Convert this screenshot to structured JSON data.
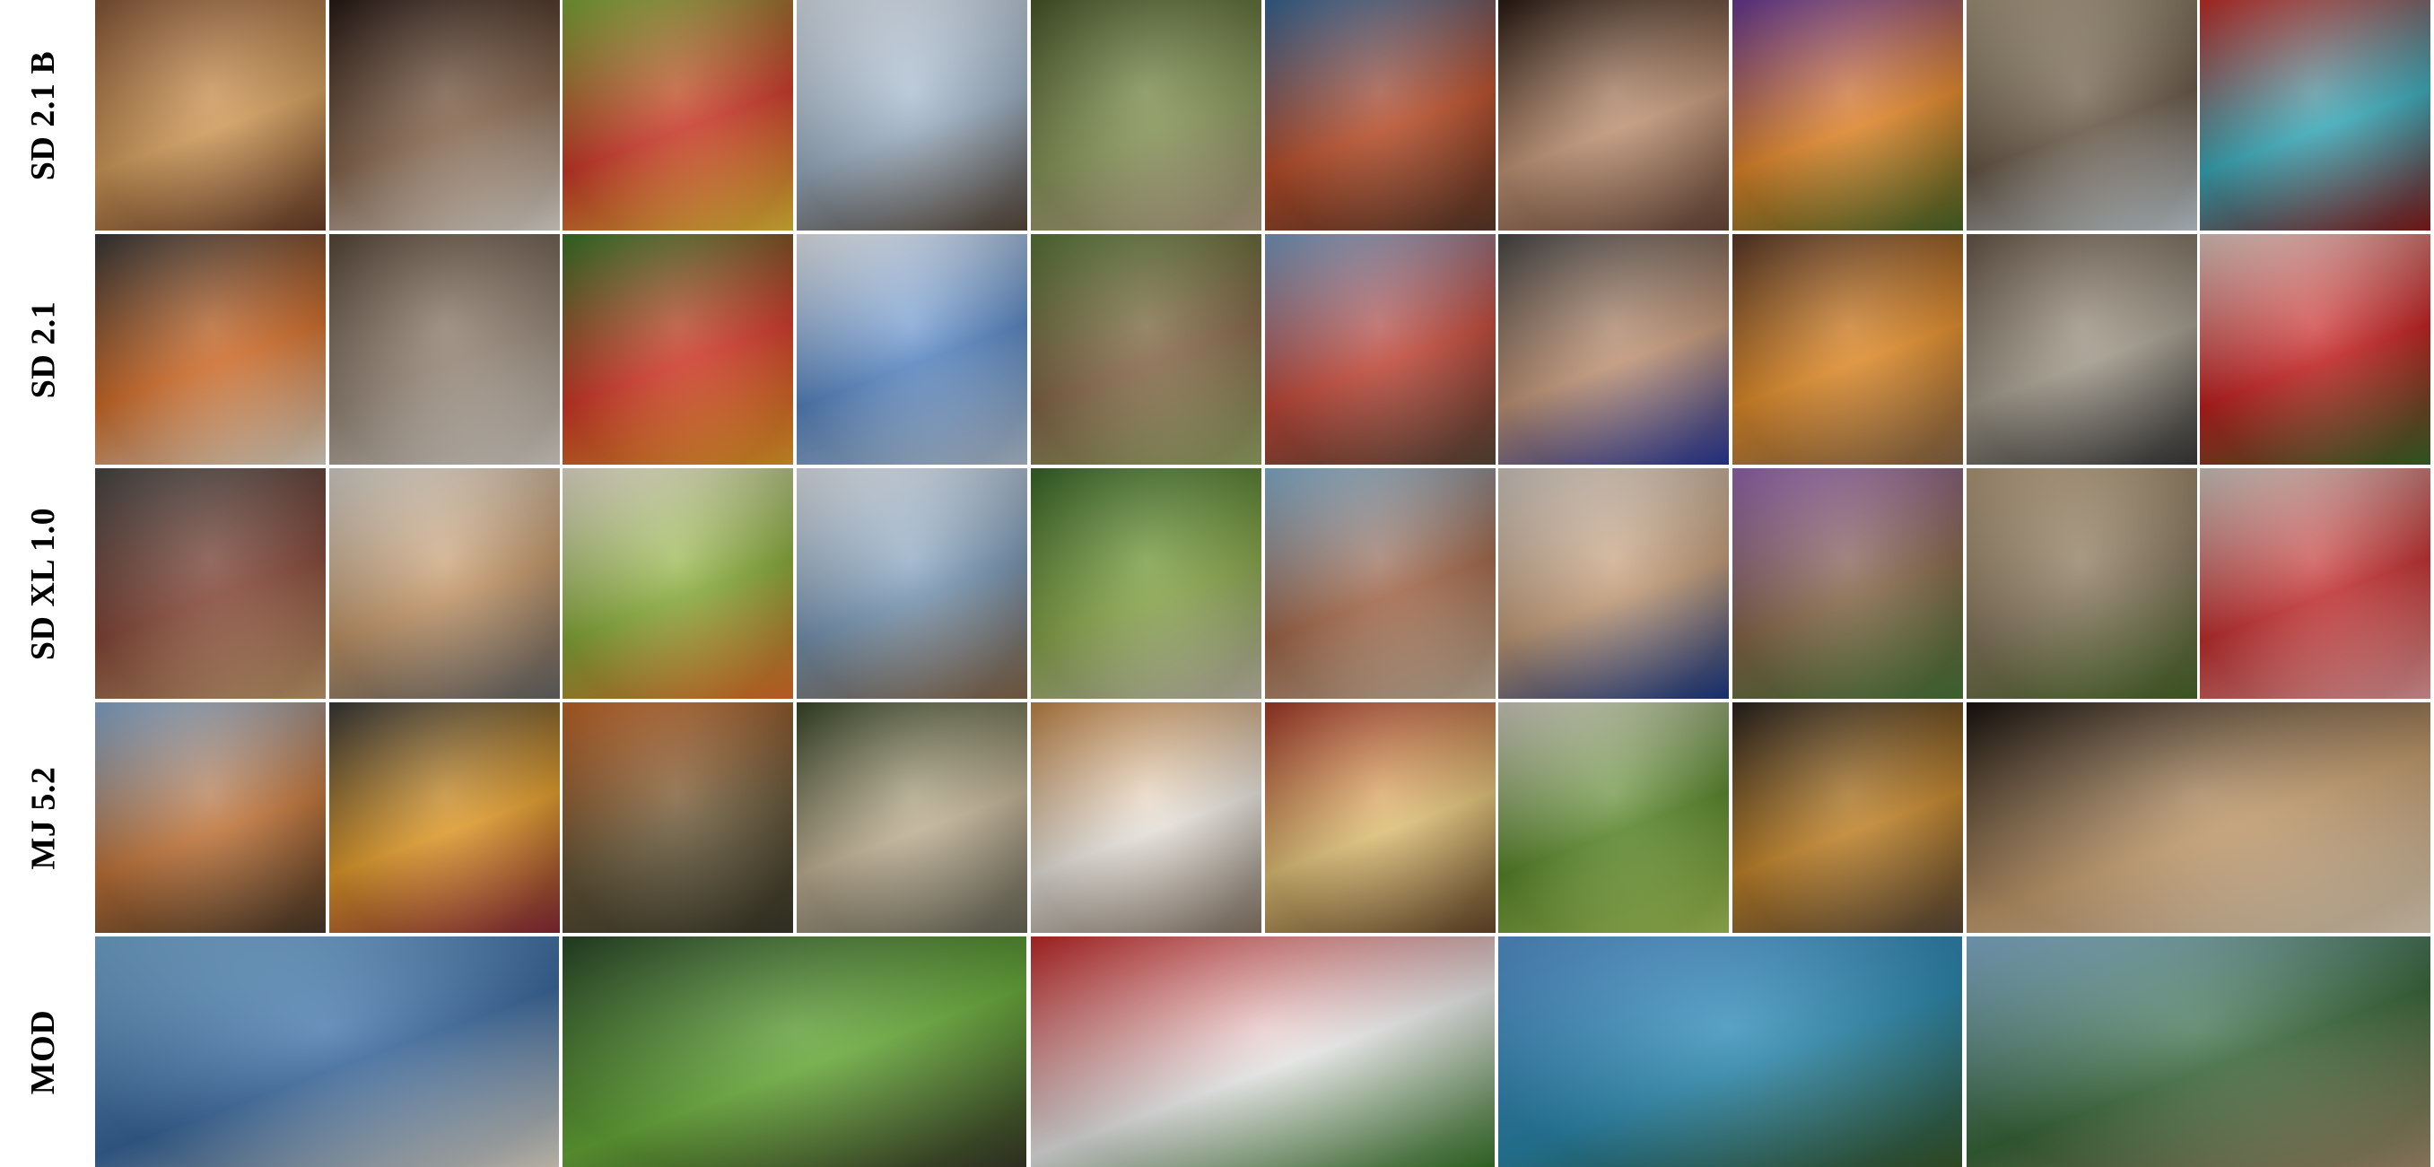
{
  "rows": [
    {
      "label": "SD 2.1 B",
      "tiles": [
        {
          "name": "food-platter-image",
          "colors": [
            "#8a5a3a",
            "#d9a15c",
            "#6b3f2a"
          ]
        },
        {
          "name": "cats-image",
          "colors": [
            "#2a1c17",
            "#8b6a50",
            "#e8e2d8"
          ]
        },
        {
          "name": "produce-stand-image",
          "colors": [
            "#7fae3a",
            "#d23a2a",
            "#e8c23a"
          ]
        },
        {
          "name": "snowy-village-image",
          "colors": [
            "#dfe8f2",
            "#9fb4c8",
            "#5a4a3a"
          ]
        },
        {
          "name": "forest-path-image",
          "colors": [
            "#4a5a2a",
            "#8a9a5a",
            "#b8a48a"
          ]
        },
        {
          "name": "crowd-image",
          "colors": [
            "#3a6a9a",
            "#c0502a",
            "#5a3a2a"
          ]
        },
        {
          "name": "man-portrait-image",
          "colors": [
            "#2a1c14",
            "#c89a7a",
            "#6a4a3a"
          ]
        },
        {
          "name": "butterfly-flower-image",
          "colors": [
            "#6a3a9a",
            "#e88a2a",
            "#4a6a2a"
          ]
        },
        {
          "name": "stone-arch-image",
          "colors": [
            "#a89a80",
            "#6a5a48",
            "#c8d4da"
          ]
        },
        {
          "name": "roses-vase-image",
          "colors": [
            "#c8302a",
            "#3ab0c0",
            "#8a1a1a"
          ]
        }
      ]
    },
    {
      "label": "SD 2.1",
      "tiles": [
        {
          "name": "food-platter-image",
          "colors": [
            "#3a3a3a",
            "#d8702a",
            "#e8e0d0"
          ]
        },
        {
          "name": "cats-image",
          "colors": [
            "#5a4a3a",
            "#9a8a7a",
            "#e0dad0"
          ]
        },
        {
          "name": "produce-stand-image",
          "colors": [
            "#3a7a2a",
            "#d83a2a",
            "#e8a02a"
          ]
        },
        {
          "name": "snowy-village-image",
          "colors": [
            "#f0f4f8",
            "#5a8ac8",
            "#b8c8d8"
          ]
        },
        {
          "name": "forest-path-image",
          "colors": [
            "#5a7a3a",
            "#8a6a4a",
            "#9aaa6a"
          ]
        },
        {
          "name": "crowd-image",
          "colors": [
            "#7aa0c8",
            "#c84a3a",
            "#5a4a3a"
          ]
        },
        {
          "name": "man-portrait-image",
          "colors": [
            "#4a4a4a",
            "#c89a7a",
            "#2a3aa0"
          ]
        },
        {
          "name": "butterfly-flower-image",
          "colors": [
            "#5a3a2a",
            "#e8902a",
            "#8a6a4a"
          ]
        },
        {
          "name": "stone-arch-image",
          "colors": [
            "#6a5a4a",
            "#a8a090",
            "#3a3a3a"
          ]
        },
        {
          "name": "roses-vase-image",
          "colors": [
            "#e8d0c8",
            "#c82020",
            "#3a6a2a"
          ]
        }
      ]
    },
    {
      "label": "SD XL 1.0",
      "tiles": [
        {
          "name": "food-platter-image",
          "colors": [
            "#4a4a48",
            "#8a4a3a",
            "#c8a070"
          ]
        },
        {
          "name": "cats-image",
          "colors": [
            "#e0dcd4",
            "#c89a6a",
            "#6a6a6a"
          ]
        },
        {
          "name": "produce-stand-image",
          "colors": [
            "#f0e8d8",
            "#8ab03a",
            "#e8702a"
          ]
        },
        {
          "name": "snowy-village-image",
          "colors": [
            "#e8eef4",
            "#7a9ab8",
            "#8a6a4a"
          ]
        },
        {
          "name": "forest-path-image",
          "colors": [
            "#3a6a2a",
            "#8aaa4a",
            "#c8c0b0"
          ]
        },
        {
          "name": "crowd-image",
          "colors": [
            "#8ab8d8",
            "#a86a4a",
            "#c8b8a0"
          ]
        },
        {
          "name": "man-portrait-image",
          "colors": [
            "#d8d0c8",
            "#c8a07a",
            "#1a3a8a"
          ]
        },
        {
          "name": "butterfly-flower-image",
          "colors": [
            "#9a6ab8",
            "#8a6a4a",
            "#4a7a3a"
          ]
        },
        {
          "name": "stone-arch-image",
          "colors": [
            "#b8a080",
            "#8a7a60",
            "#4a6a2a"
          ]
        },
        {
          "name": "roses-vase-image",
          "colors": [
            "#d8d0c8",
            "#c83030",
            "#e8a0a0"
          ]
        }
      ]
    },
    {
      "label": "MJ 5.2",
      "tiles": [
        {
          "name": "baseball-player-image",
          "colors": [
            "#8ab0d8",
            "#c8783a",
            "#4a3a2a"
          ]
        },
        {
          "name": "cooking-pot-image",
          "colors": [
            "#3a3a3a",
            "#e8a02a",
            "#8a2a3a"
          ]
        },
        {
          "name": "autumn-lake-image",
          "colors": [
            "#c86a2a",
            "#6a5a3a",
            "#3a3a2a"
          ]
        },
        {
          "name": "winged-lion-image",
          "colors": [
            "#3a4a2a",
            "#c8b89a",
            "#6a6a5a"
          ]
        },
        {
          "name": "dog-cat-bed-image",
          "colors": [
            "#c88a4a",
            "#f0ece4",
            "#8a7a6a"
          ]
        },
        {
          "name": "retro-kitchen-image",
          "colors": [
            "#a83a2a",
            "#e8c87a",
            "#6a4a2a"
          ]
        },
        {
          "name": "broccoli-image",
          "colors": [
            "#d8d4c8",
            "#5a8a2a",
            "#a8c85a"
          ]
        },
        {
          "name": "steam-train-image",
          "colors": [
            "#2a2420",
            "#c8882a",
            "#5a4a3a"
          ]
        },
        {
          "name": "wedding-cake-image",
          "colors": [
            "#1a1410",
            "#c8a070",
            "#e8d8c0"
          ],
          "wide": 2
        }
      ]
    },
    {
      "label": "MOD",
      "tiles": [
        {
          "name": "harbor-city-image",
          "colors": [
            "#7ab0d8",
            "#3a6aa0",
            "#e8e0d0"
          ],
          "wide": 2
        },
        {
          "name": "frogs-bird-image",
          "colors": [
            "#2a4a2a",
            "#6ab03a",
            "#3a3a2a"
          ],
          "wide": 2
        },
        {
          "name": "flower-field-image",
          "colors": [
            "#c82a2a",
            "#f0f0f0",
            "#3a7a2a"
          ],
          "wide": 2
        },
        {
          "name": "mountain-lake-cabin-image",
          "colors": [
            "#5a9ad8",
            "#2a8ab0",
            "#3a5a2a"
          ],
          "wide": 2
        },
        {
          "name": "cliff-trees-lake-image",
          "colors": [
            "#8ab8d8",
            "#3a6a3a",
            "#a89070"
          ],
          "wide": 2
        }
      ]
    }
  ]
}
